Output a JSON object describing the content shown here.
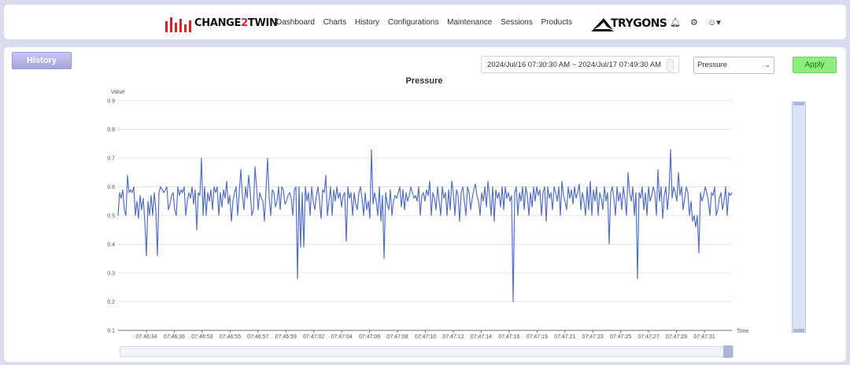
{
  "header": {
    "brand": {
      "part1": "CHANGE",
      "part2": "2",
      "part3": "TWIN"
    },
    "nav": [
      "Dashboard",
      "Charts",
      "History",
      "Configurations",
      "Maintenance",
      "Sessions",
      "Products"
    ],
    "partner": "TRYGONS",
    "icons": [
      "bell-icon",
      "gear-icon",
      "user-icon"
    ]
  },
  "controls": {
    "history_label": "History",
    "date_range": "2024/Jul/16 07:30:30 AM ~ 2024/Jul/17 07:49:30 AM",
    "selected_metric": "Pressure",
    "apply_label": "Apply"
  },
  "colors": {
    "accent_green": "#8ded7d",
    "series_blue": "#5470c6",
    "brand_red": "#d8202a"
  },
  "chart_data": {
    "type": "line",
    "title": "Pressure",
    "ylabel": "Value",
    "xlabel": "Time",
    "ylim": [
      0.1,
      0.9
    ],
    "yticks": [
      0.1,
      0.2,
      0.3,
      0.4,
      0.5,
      0.6,
      0.7,
      0.8,
      0.9
    ],
    "xticks": [
      "07:46:34",
      "07:46:36",
      "07:46:53",
      "07:46:55",
      "07:46:57",
      "07:46:59",
      "07:47:02",
      "07:47:04",
      "07:47:06",
      "07:47:08",
      "07:47:10",
      "07:47:12",
      "07:47:14",
      "07:47:16",
      "07:47:19",
      "07:47:21",
      "07:47:23",
      "07:47:25",
      "07:47:27",
      "07:47:29",
      "07:47:31"
    ],
    "series": [
      {
        "values": [
          0.5,
          0.58,
          0.56,
          0.59,
          0.52,
          0.5,
          0.64,
          0.58,
          0.59,
          0.58,
          0.6,
          0.5,
          0.55,
          0.49,
          0.57,
          0.52,
          0.56,
          0.48,
          0.36,
          0.55,
          0.5,
          0.57,
          0.5,
          0.58,
          0.52,
          0.36,
          0.58,
          0.6,
          0.59,
          0.58,
          0.59,
          0.6,
          0.52,
          0.54,
          0.57,
          0.58,
          0.52,
          0.5,
          0.6,
          0.57,
          0.59,
          0.58,
          0.6,
          0.5,
          0.55,
          0.58,
          0.56,
          0.6,
          0.54,
          0.59,
          0.45,
          0.58,
          0.57,
          0.7,
          0.5,
          0.6,
          0.5,
          0.58,
          0.55,
          0.59,
          0.52,
          0.6,
          0.58,
          0.6,
          0.5,
          0.58,
          0.53,
          0.59,
          0.56,
          0.62,
          0.54,
          0.57,
          0.48,
          0.55,
          0.58,
          0.6,
          0.5,
          0.58,
          0.66,
          0.57,
          0.52,
          0.6,
          0.56,
          0.64,
          0.58,
          0.5,
          0.52,
          0.67,
          0.6,
          0.52,
          0.58,
          0.56,
          0.55,
          0.48,
          0.59,
          0.7,
          0.56,
          0.5,
          0.59,
          0.58,
          0.53,
          0.55,
          0.6,
          0.52,
          0.6,
          0.59,
          0.54,
          0.55,
          0.57,
          0.58,
          0.56,
          0.5,
          0.59,
          0.6,
          0.28,
          0.6,
          0.39,
          0.58,
          0.39,
          0.6,
          0.55,
          0.58,
          0.5,
          0.6,
          0.55,
          0.52,
          0.57,
          0.6,
          0.55,
          0.49,
          0.59,
          0.58,
          0.64,
          0.5,
          0.55,
          0.6,
          0.5,
          0.59,
          0.55,
          0.6,
          0.56,
          0.58,
          0.53,
          0.57,
          0.58,
          0.41,
          0.6,
          0.56,
          0.58,
          0.5,
          0.58,
          0.54,
          0.52,
          0.58,
          0.6,
          0.56,
          0.5,
          0.58,
          0.52,
          0.55,
          0.49,
          0.73,
          0.54,
          0.58,
          0.55,
          0.5,
          0.6,
          0.48,
          0.57,
          0.35,
          0.58,
          0.54,
          0.52,
          0.59,
          0.5,
          0.55,
          0.57,
          0.56,
          0.58,
          0.6,
          0.53,
          0.59,
          0.52,
          0.58,
          0.55,
          0.57,
          0.6,
          0.58,
          0.56,
          0.57,
          0.55,
          0.6,
          0.5,
          0.57,
          0.58,
          0.55,
          0.59,
          0.57,
          0.62,
          0.5,
          0.58,
          0.56,
          0.52,
          0.6,
          0.55,
          0.5,
          0.6,
          0.56,
          0.58,
          0.5,
          0.59,
          0.52,
          0.62,
          0.58,
          0.5,
          0.59,
          0.57,
          0.48,
          0.58,
          0.6,
          0.55,
          0.5,
          0.6,
          0.58,
          0.52,
          0.56,
          0.59,
          0.61,
          0.57,
          0.55,
          0.5,
          0.58,
          0.55,
          0.6,
          0.53,
          0.62,
          0.57,
          0.5,
          0.6,
          0.48,
          0.59,
          0.56,
          0.58,
          0.53,
          0.6,
          0.52,
          0.6,
          0.56,
          0.58,
          0.55,
          0.57,
          0.2,
          0.58,
          0.6,
          0.5,
          0.58,
          0.55,
          0.6,
          0.52,
          0.6,
          0.57,
          0.5,
          0.58,
          0.53,
          0.6,
          0.55,
          0.6,
          0.57,
          0.59,
          0.5,
          0.58,
          0.6,
          0.48,
          0.6,
          0.56,
          0.58,
          0.52,
          0.6,
          0.58,
          0.55,
          0.6,
          0.5,
          0.62,
          0.57,
          0.55,
          0.52,
          0.6,
          0.56,
          0.59,
          0.54,
          0.6,
          0.56,
          0.58,
          0.61,
          0.52,
          0.58,
          0.55,
          0.5,
          0.6,
          0.52,
          0.62,
          0.5,
          0.59,
          0.55,
          0.6,
          0.5,
          0.58,
          0.56,
          0.52,
          0.6,
          0.55,
          0.58,
          0.4,
          0.58,
          0.6,
          0.56,
          0.5,
          0.6,
          0.55,
          0.58,
          0.52,
          0.6,
          0.56,
          0.5,
          0.65,
          0.58,
          0.55,
          0.6,
          0.5,
          0.58,
          0.28,
          0.58,
          0.56,
          0.6,
          0.52,
          0.58,
          0.5,
          0.6,
          0.55,
          0.57,
          0.6,
          0.58,
          0.5,
          0.66,
          0.55,
          0.6,
          0.49,
          0.57,
          0.6,
          0.52,
          0.58,
          0.73,
          0.56,
          0.6,
          0.58,
          0.55,
          0.65,
          0.57,
          0.6,
          0.52,
          0.56,
          0.6,
          0.58,
          0.5,
          0.55,
          0.48,
          0.5,
          0.46,
          0.5,
          0.37,
          0.58,
          0.55,
          0.57,
          0.6,
          0.58,
          0.55,
          0.5,
          0.58,
          0.57,
          0.6,
          0.5,
          0.52,
          0.56,
          0.58,
          0.52,
          0.55,
          0.6,
          0.5,
          0.58,
          0.57,
          0.58
        ]
      }
    ]
  }
}
